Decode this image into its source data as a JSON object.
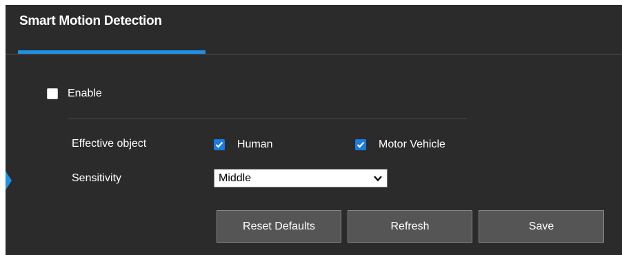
{
  "header": {
    "title": "Smart Motion Detection"
  },
  "enable": {
    "label": "Enable",
    "checked": false
  },
  "effective_object": {
    "label": "Effective object",
    "options": [
      {
        "label": "Human",
        "checked": true
      },
      {
        "label": "Motor Vehicle",
        "checked": true
      }
    ]
  },
  "sensitivity": {
    "label": "Sensitivity",
    "value": "Middle"
  },
  "buttons": {
    "reset": "Reset Defaults",
    "refresh": "Refresh",
    "save": "Save"
  },
  "colors": {
    "accent": "#1e90e6",
    "checkbox": "#1a7be0",
    "panel_bg": "#2b2b2b",
    "button_bg": "#555555"
  }
}
